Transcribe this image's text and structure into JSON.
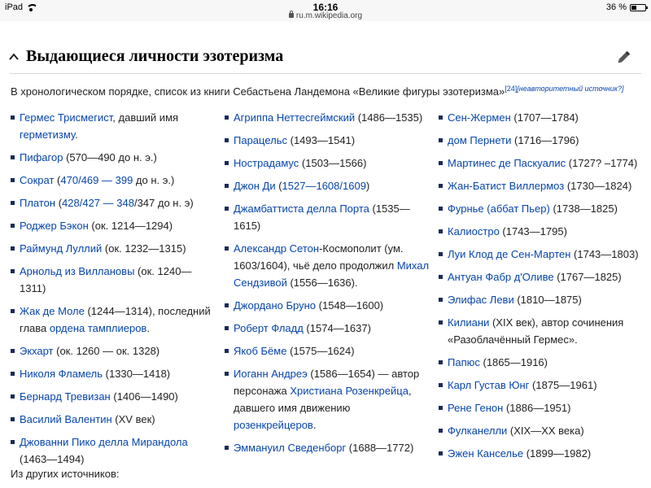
{
  "status_bar": {
    "device": "iPad",
    "time": "16:16",
    "url": "ru.m.wikipedia.org",
    "battery_text": "36 %",
    "battery_level": 0.36
  },
  "section": {
    "title": "Выдающиеся личности эзотеризма",
    "intro": "В хронологическом порядке, список из книги Себастьена Ландемона «Великие фигуры эзотеризма»",
    "ref": "[24]",
    "ref_note": "[неавторитетный источник?]"
  },
  "columns": [
    [
      {
        "parts": [
          {
            "t": "Гермес Трисмегист",
            "link": true
          },
          {
            "t": ", давший имя "
          },
          {
            "t": "герметизму",
            "link": true
          },
          {
            "t": "."
          }
        ]
      },
      {
        "parts": [
          {
            "t": "Пифагор",
            "link": true
          },
          {
            "t": " (570—490 до н. э.)"
          }
        ]
      },
      {
        "parts": [
          {
            "t": "Сократ",
            "link": true
          },
          {
            "t": " ("
          },
          {
            "t": "470/469 — 399",
            "link": true
          },
          {
            "t": " до н. э.)"
          }
        ]
      },
      {
        "parts": [
          {
            "t": "Платон",
            "link": true
          },
          {
            "t": " ("
          },
          {
            "t": "428/427 — 348",
            "link": true
          },
          {
            "t": "/347 до н. э)"
          }
        ]
      },
      {
        "parts": [
          {
            "t": "Роджер Бэкон",
            "link": true
          },
          {
            "t": " (ок. 1214—1294)"
          }
        ]
      },
      {
        "parts": [
          {
            "t": "Раймунд Луллий",
            "link": true
          },
          {
            "t": " (ок. 1232—1315)"
          }
        ]
      },
      {
        "parts": [
          {
            "t": "Арнольд из Виллановы",
            "link": true
          },
          {
            "t": " (ок. 1240—1311)"
          }
        ]
      },
      {
        "parts": [
          {
            "t": "Жак де Моле",
            "link": true
          },
          {
            "t": " (1244—1314), последний глава "
          },
          {
            "t": "ордена тамплиеров",
            "link": true
          },
          {
            "t": "."
          }
        ]
      },
      {
        "parts": [
          {
            "t": "Экхарт",
            "link": true
          },
          {
            "t": " (ок. 1260 — ок. 1328)"
          }
        ]
      },
      {
        "parts": [
          {
            "t": "Николя Фламель",
            "link": true
          },
          {
            "t": " (1330—1418)"
          }
        ]
      },
      {
        "parts": [
          {
            "t": "Бернард Тревизан",
            "link": true
          },
          {
            "t": " (1406—1490)"
          }
        ]
      },
      {
        "parts": [
          {
            "t": "Василий Валентин",
            "link": true
          },
          {
            "t": " (XV век)"
          }
        ]
      },
      {
        "parts": [
          {
            "t": "Джованни Пико делла Мирандола",
            "link": true
          },
          {
            "t": " (1463—1494)"
          }
        ]
      }
    ],
    [
      {
        "parts": [
          {
            "t": "Агриппа Неттесгеймский",
            "link": true
          },
          {
            "t": " (1486—1535)"
          }
        ]
      },
      {
        "parts": [
          {
            "t": "Парацельс",
            "link": true
          },
          {
            "t": " (1493—1541)"
          }
        ]
      },
      {
        "parts": [
          {
            "t": "Нострадамус",
            "link": true
          },
          {
            "t": " (1503—1566)"
          }
        ]
      },
      {
        "parts": [
          {
            "t": "Джон Ди",
            "link": true
          },
          {
            "t": " ("
          },
          {
            "t": "1527—1608/1609",
            "link": true
          },
          {
            "t": ")"
          }
        ]
      },
      {
        "parts": [
          {
            "t": "Джамбаттиста делла Порта",
            "link": true
          },
          {
            "t": " (1535—1615)"
          }
        ]
      },
      {
        "parts": [
          {
            "t": "Александр Сетон",
            "link": true
          },
          {
            "t": "-Космополит (ум. 1603/1604), чьё дело продолжил "
          },
          {
            "t": "Михал Сендзивой",
            "link": true
          },
          {
            "t": " (1556—1636)."
          }
        ]
      },
      {
        "parts": [
          {
            "t": "Джордано Бруно",
            "link": true
          },
          {
            "t": " (1548—1600)"
          }
        ]
      },
      {
        "parts": [
          {
            "t": "Роберт Фладд",
            "link": true
          },
          {
            "t": " (1574—1637)"
          }
        ]
      },
      {
        "parts": [
          {
            "t": "Якоб Бёме",
            "link": true
          },
          {
            "t": " (1575—1624)"
          }
        ]
      },
      {
        "parts": [
          {
            "t": "Иоганн Андреэ",
            "link": true
          },
          {
            "t": " (1586—1654) — автор персонажа "
          },
          {
            "t": "Христиана Розенкрейца",
            "link": true
          },
          {
            "t": ", давшего имя движению "
          },
          {
            "t": "розенкрейцеров",
            "link": true
          },
          {
            "t": "."
          }
        ]
      },
      {
        "parts": [
          {
            "t": "Эммануил Сведенборг",
            "link": true
          },
          {
            "t": " (1688—1772)"
          }
        ]
      }
    ],
    [
      {
        "parts": [
          {
            "t": "Сен-Жермен",
            "link": true
          },
          {
            "t": " (1707—1784)"
          }
        ]
      },
      {
        "parts": [
          {
            "t": "дом Пернети",
            "link": true
          },
          {
            "t": " (1716—1796)"
          }
        ]
      },
      {
        "parts": [
          {
            "t": "Мартинес де Паскуалис",
            "link": true
          },
          {
            "t": " (1727? –1774)"
          }
        ]
      },
      {
        "parts": [
          {
            "t": "Жан-Батист Виллермоз",
            "link": true
          },
          {
            "t": " (1730—1824)"
          }
        ]
      },
      {
        "parts": [
          {
            "t": "Фурнье (аббат Пьер)",
            "link": true
          },
          {
            "t": " (1738—1825)"
          }
        ]
      },
      {
        "parts": [
          {
            "t": "Калиостро",
            "link": true
          },
          {
            "t": " (1743—1795)"
          }
        ]
      },
      {
        "parts": [
          {
            "t": "Луи Клод де Сен-Мартен",
            "link": true
          },
          {
            "t": " (1743—1803)"
          }
        ]
      },
      {
        "parts": [
          {
            "t": "Антуан Фабр д'Оливе",
            "link": true
          },
          {
            "t": " (1767—1825)"
          }
        ]
      },
      {
        "parts": [
          {
            "t": "Элифас Леви",
            "link": true
          },
          {
            "t": " (1810—1875)"
          }
        ]
      },
      {
        "parts": [
          {
            "t": "Килиани",
            "link": true
          },
          {
            "t": " (XIX век), автор сочинения «Разоблачённый Гермес»."
          }
        ]
      },
      {
        "parts": [
          {
            "t": "Папюс",
            "link": true
          },
          {
            "t": " (1865—1916)"
          }
        ]
      },
      {
        "parts": [
          {
            "t": "Карл Густав Юнг",
            "link": true
          },
          {
            "t": " (1875—1961)"
          }
        ]
      },
      {
        "parts": [
          {
            "t": "Рене Генон",
            "link": true
          },
          {
            "t": " (1886—1951)"
          }
        ]
      },
      {
        "parts": [
          {
            "t": "Фулканелли",
            "link": true
          },
          {
            "t": " (XIX—XX века)"
          }
        ]
      },
      {
        "parts": [
          {
            "t": "Эжен Канселье",
            "link": true
          },
          {
            "t": " (1899—1982)"
          }
        ]
      }
    ]
  ],
  "footer_text": "Из других источников:",
  "icons": {
    "collapse": "chevron-up-icon",
    "edit": "pencil-icon",
    "wifi": "wifi-icon",
    "battery": "battery-icon",
    "lock": "lock-icon"
  },
  "colors": {
    "link": "#0645ad",
    "text": "#222222",
    "bullet": "#1a2a5a"
  }
}
